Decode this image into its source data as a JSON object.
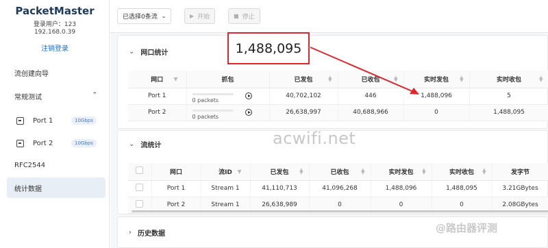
{
  "sidebar": {
    "brand": "PacketMaster",
    "user": "登录用户：123",
    "ip": "192.168.0.39",
    "logout": "注销登录",
    "nav": {
      "flow_wizard": "流创建向导",
      "regular_test": "常规测试",
      "rfc": "RFC2544",
      "stats": "统计数据"
    },
    "ports": [
      {
        "label": "Port 1",
        "speed": "10Gbps"
      },
      {
        "label": "Port 2",
        "speed": "10Gbps"
      }
    ]
  },
  "toolbar": {
    "select_label": "已选择0条流",
    "start_label": "开始",
    "stop_label": "停止"
  },
  "port_stats": {
    "title": "网口统计",
    "headers": [
      "网口",
      "抓包",
      "已发包",
      "已收包",
      "实时发包",
      "实时收包"
    ],
    "rows": [
      {
        "port": "Port 1",
        "capture": "0 packets",
        "sent": "40,702,102",
        "received": "446",
        "rt_sent": "1,488,096",
        "rt_recv": "5"
      },
      {
        "port": "Port 2",
        "capture": "0 packets",
        "sent": "26,638,997",
        "received": "40,688,966",
        "rt_sent": "0",
        "rt_recv": "1,488,095"
      }
    ]
  },
  "flow_stats": {
    "title": "流统计",
    "headers": [
      "网口",
      "流ID",
      "已发包",
      "已收包",
      "实时发包",
      "实时收包",
      "发字节"
    ],
    "rows": [
      {
        "port": "Port 1",
        "flow": "Stream 1",
        "sent": "41,110,713",
        "received": "41,096,268",
        "rt_sent": "1,488,096",
        "rt_recv": "1,488,095",
        "bytes": "3.21GBytes"
      },
      {
        "port": "Port 2",
        "flow": "Stream 1",
        "sent": "26,638,989",
        "received": "0",
        "rt_sent": "0",
        "rt_recv": "0",
        "bytes": "2.08GBytes"
      }
    ]
  },
  "history": {
    "title": "历史数据"
  },
  "annotation": {
    "callout_value": "1,488,095",
    "watermark": "acwifi.net",
    "watermark_corner": "@路由器评测",
    "color": "#e0262b"
  }
}
